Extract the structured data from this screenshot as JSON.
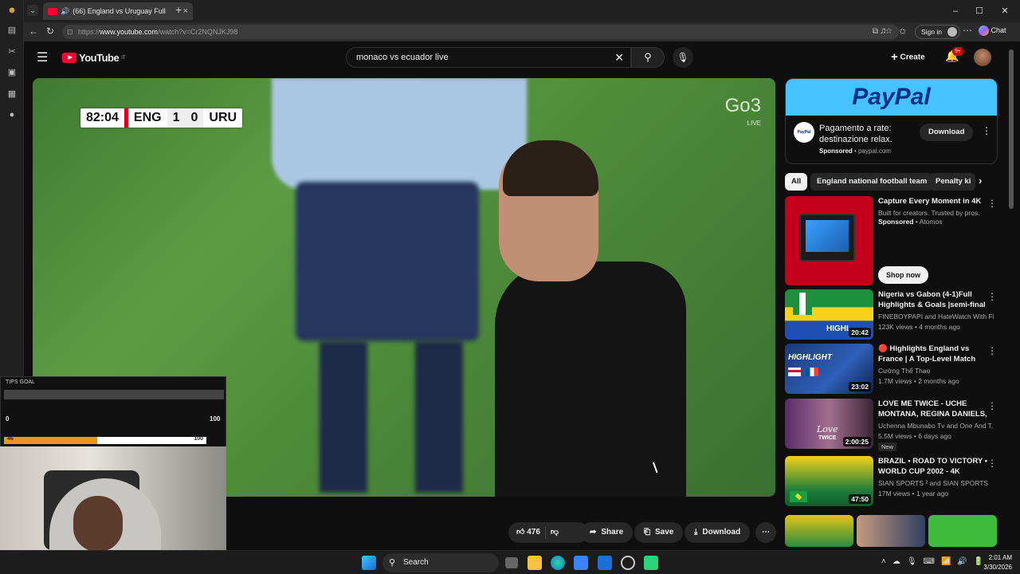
{
  "browser": {
    "tab_title": "(66) England vs Uruguay Full",
    "url_prefix": "https://",
    "url_host": "www.youtube.com",
    "url_path": "/watch?v=Cr2NQNJKJ98",
    "sign_in": "Sign in",
    "chat": "Chat",
    "new_tab_symbol": "+",
    "minimize_symbol": "–",
    "maximize_symbol": "☐",
    "close_symbol": "✕"
  },
  "youtube": {
    "logo_text": "YouTube",
    "country_code": "IT",
    "search_value": "monaco vs ecuador live",
    "create_label": "Create",
    "notif_count": "9+"
  },
  "video": {
    "clock": "82:04",
    "team_home": "ENG",
    "score_home": "1",
    "score_away": "0",
    "team_away": "URU",
    "channel_bug": "Go3",
    "live_label": "LIVE"
  },
  "overlay": {
    "tips_title": "TIPS GOAL",
    "tips_min": "0",
    "tips_max": "100",
    "goal_current": "46",
    "goal_max": "100",
    "goal_progress": 0.46
  },
  "actions": {
    "likes": "476",
    "share": "Share",
    "save": "Save",
    "download": "Download"
  },
  "ad": {
    "banner": "PayPal",
    "logo_text": "PayPal",
    "line1": "Pagamento a rate:",
    "line2": "destinazione relax.",
    "sponsored": "Sponsored",
    "domain": "paypal.com",
    "button": "Download"
  },
  "chips": [
    "All",
    "England national football team",
    "Penalty ki"
  ],
  "recommendations": [
    {
      "title": "Capture Every Moment in 4K",
      "line1": "Built for creators. Trusted by pros.",
      "line2": "Sponsored",
      "line2b": "Atomos",
      "button": "Shop now",
      "duration": ""
    },
    {
      "title": "Nigeria vs Gabon (4-1)Full Highlights & Goals |semi-final ...",
      "line1": "FINEBOYPAPI and HateWatch With Fineb...",
      "line2": "123K views • 4 months ago",
      "duration": "20:42"
    },
    {
      "title": "🔴 Highlights England vs France | A Top-Level Match Th...",
      "line1": "Cường Thể Thao",
      "line2": "1.7M views • 2 months ago",
      "duration": "23:02"
    },
    {
      "title": "LOVE ME TWICE - UCHE MONTANA, REGINA DANIELS, ...",
      "line1": "Uchenna Mbunabo Tv and One And T...",
      "line2": "5.5M views • 6 days ago",
      "badge": "New",
      "duration": "2:00:25"
    },
    {
      "title": "BRAZIL • ROAD TO VICTORY • WORLD CUP 2002 - 4K",
      "line1": "SIAN SPORTS ² and SIAN SPORTS",
      "line2": "17M views • 1 year ago",
      "duration": "47:50"
    }
  ],
  "thumb_text": {
    "rec2": "HIGHL",
    "rec3": "HIGHLIGHT",
    "rec4a": "Love",
    "rec4b": "TWICE"
  },
  "taskbar": {
    "search": "Search",
    "time": "2:01 AM",
    "date": "3/30/2026"
  },
  "colors": {
    "youtube_red": "#ff0033",
    "paypal_blue": "#003087",
    "paypal_bg": "#46c2ff",
    "goal_orange": "#f29318"
  }
}
